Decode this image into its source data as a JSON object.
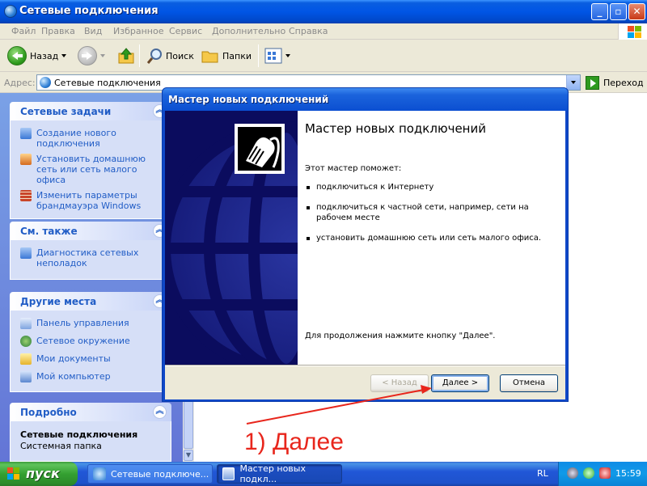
{
  "window": {
    "title": "Сетевые подключения"
  },
  "menu": {
    "items": [
      "Файл",
      "Правка",
      "Вид",
      "Избранное",
      "Сервис",
      "Дополнительно",
      "Справка"
    ]
  },
  "toolbar": {
    "back_label": "Назад",
    "search_label": "Поиск",
    "folders_label": "Папки"
  },
  "address": {
    "label": "Адрес:",
    "value": "Сетевые подключения",
    "go_label": "Переход"
  },
  "taskpane": {
    "network_tasks": {
      "title": "Сетевые задачи",
      "items": [
        "Создание нового подключения",
        "Установить домашнюю сеть или сеть малого офиса",
        "Изменить параметры брандмауэра Windows"
      ]
    },
    "see_also": {
      "title": "См. также",
      "items": [
        "Диагностика сетевых неполадок"
      ]
    },
    "other_places": {
      "title": "Другие места",
      "items": [
        "Панель управления",
        "Сетевое окружение",
        "Мои документы",
        "Мой компьютер"
      ]
    },
    "details": {
      "title": "Подробно",
      "name": "Сетевые подключения",
      "type": "Системная папка"
    }
  },
  "wizard": {
    "title": "Мастер новых подключений",
    "heading": "Мастер новых подключений",
    "intro": "Этот мастер поможет:",
    "bullets": [
      "подключиться к Интернету",
      "подключиться к частной сети, например, сети на рабочем месте",
      "установить домашнюю сеть или сеть малого офиса."
    ],
    "continue_text": "Для продолжения нажмите кнопку \"Далее\".",
    "back_button": "< Назад",
    "next_button": "Далее >",
    "cancel_button": "Отмена"
  },
  "annotation": {
    "text": "1) Далее",
    "color": "#e8261c"
  },
  "taskbar": {
    "start_label": "пуск",
    "tasks": [
      "Сетевые подключе...",
      "Мастер новых подкл..."
    ],
    "language": "RL",
    "clock": "15:59"
  },
  "colors": {
    "xp_blue": "#0055e5",
    "link_blue": "#215dc6",
    "taskpane_bg": "#7aa1e6"
  }
}
